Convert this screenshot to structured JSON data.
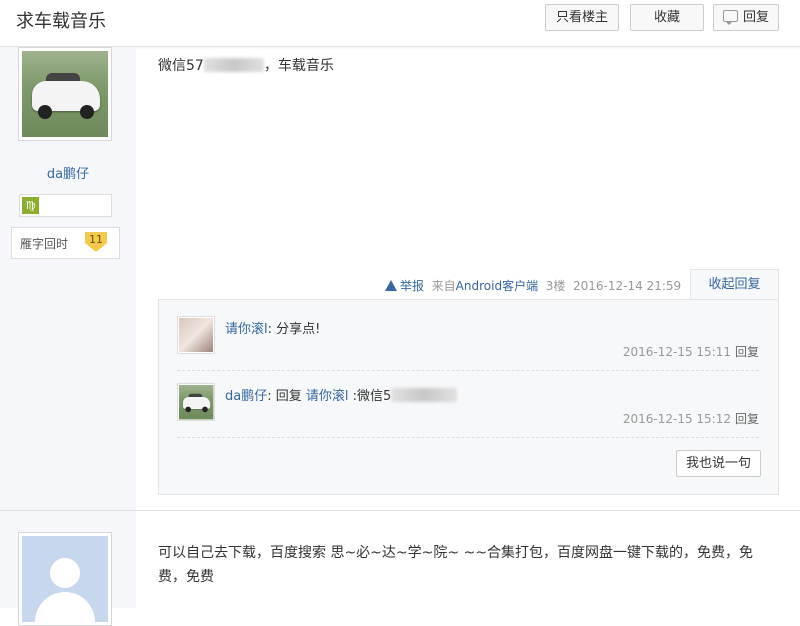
{
  "header": {
    "title": "求车载音乐",
    "only_lz_label": "只看楼主",
    "favorite_label": "收藏",
    "reply_label": "回复"
  },
  "post1": {
    "author": "da鹏仔",
    "level_icon": "level-badge-icon",
    "badge_text": "雁字回时",
    "badge_level": "11",
    "content_prefix": "微信57",
    "content_suffix": "，车载音乐",
    "tail": {
      "report_label": "举报",
      "source_prefix": "来自",
      "source_app": "Android客户端",
      "floor": "3楼",
      "time": "2016-12-14 21:59",
      "fold_label": "收起回复"
    },
    "replies": [
      {
        "author": "请你滚l",
        "separator": ": ",
        "text": "分享点!",
        "time": "2016-12-15 15:11",
        "reply_label": "回复"
      },
      {
        "author": "da鹏仔",
        "separator": ": ",
        "text_prefix": "回复 ",
        "reply_to": "请你滚l",
        "text_suffix": " :微信5",
        "time": "2016-12-15 15:12",
        "reply_label": "回复"
      }
    ],
    "say_label": "我也说一句"
  },
  "post2": {
    "content": "可以自己去下载，百度搜索 思~必~达~学~院~ ~~合集打包，百度网盘一键下载的，免费，免费，免费"
  }
}
